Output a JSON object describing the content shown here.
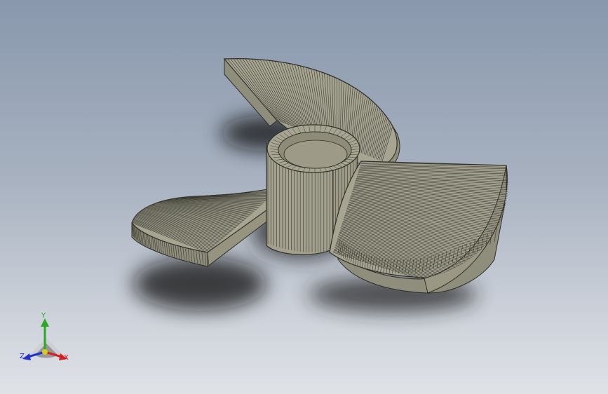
{
  "viewport": {
    "background_top": "#8998ad",
    "background_bottom": "#dfe2e7"
  },
  "model": {
    "body_color": "#a7a592",
    "edge_color": "#2f2f28",
    "shadow_color": "#1a1a1a"
  },
  "triad": {
    "x_label": "X",
    "y_label": "Y",
    "z_label": "Z",
    "x_color": "#d42020",
    "y_color": "#2aa82a",
    "z_color": "#2233cc"
  }
}
